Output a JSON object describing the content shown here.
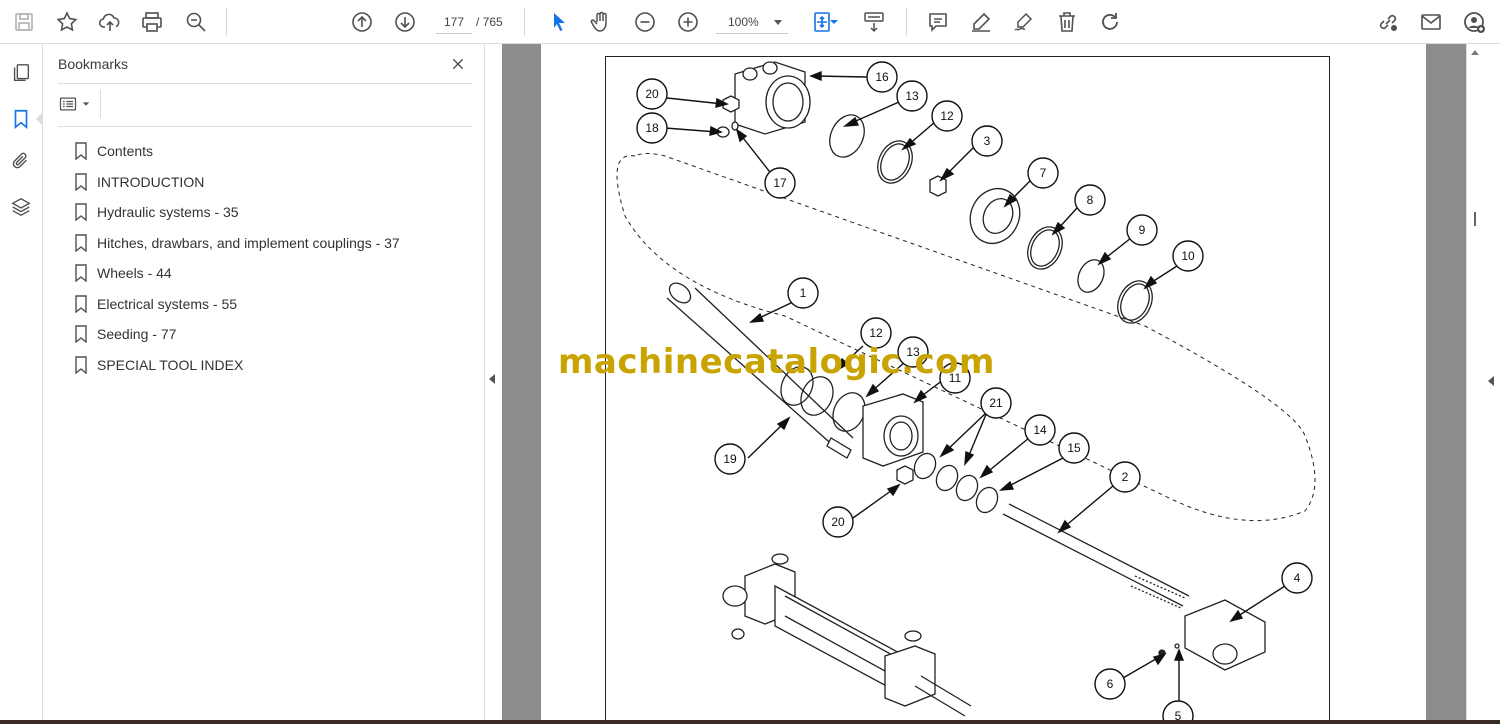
{
  "toolbar": {
    "current_page": "177",
    "page_total": "/ 765",
    "zoom": "100%",
    "icons": [
      "save-icon",
      "star-icon",
      "upload-icon",
      "print-icon",
      "zoom-search-icon",
      "page-up-icon",
      "page-down-icon",
      "select-cursor-icon",
      "hand-icon",
      "zoom-out-icon",
      "zoom-in-icon",
      "fit-page-icon",
      "scroll-mode-icon",
      "comment-icon",
      "highlight-pen-icon",
      "sign-icon",
      "delete-icon",
      "rotate-icon",
      "share-link-icon",
      "mail-icon",
      "account-icon"
    ]
  },
  "bookmarks": {
    "title": "Bookmarks",
    "items": [
      {
        "label": "Contents"
      },
      {
        "label": "INTRODUCTION"
      },
      {
        "label": "Hydraulic systems - 35"
      },
      {
        "label": "Hitches, drawbars, and implement couplings - 37"
      },
      {
        "label": "Wheels - 44"
      },
      {
        "label": "Electrical systems - 55"
      },
      {
        "label": "Seeding - 77"
      },
      {
        "label": "SPECIAL TOOL INDEX"
      }
    ]
  },
  "document": {
    "watermark": "machinecatalogic.com",
    "callouts": [
      "16",
      "20",
      "13",
      "12",
      "18",
      "3",
      "17",
      "7",
      "8",
      "9",
      "10",
      "1",
      "12",
      "13",
      "11",
      "21",
      "14",
      "19",
      "15",
      "2",
      "20",
      "4",
      "6",
      "5"
    ]
  },
  "colors": {
    "accent": "#1473e6",
    "watermark": "#c9a400",
    "workspace": "#8c8c8c"
  }
}
